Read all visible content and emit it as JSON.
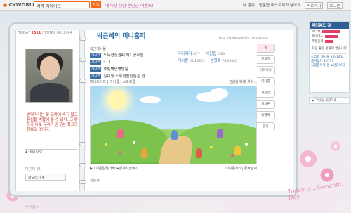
{
  "topbar": {
    "logo": "CYWORLD",
    "search_value": "박봉 리에이크",
    "search_button": "검색",
    "promo": "예식장 싱담·혼인금 이벤트!",
    "nav": [
      "내 홈피",
      "방문한 히스토리가 남아요",
      "비로가기",
      "로그인"
    ]
  },
  "left_page": {
    "today_label": "TODAY",
    "today_value": "2511",
    "total_label": "TOTAL",
    "total_value": "8012004",
    "quote": "번역거리는 꽃 모양에 속지 않고 진심을 벅뽑에 볼 수 있다. 그 렁하가 바로 우리가 꿈꾸는 최고의 행복일 것이다.",
    "history_label": "HISTORY",
    "owner_name": "박근혜",
    "owner_suffix": "(9)",
    "pado_label": "파도타기"
  },
  "right_page": {
    "title": "박근혜의 미니홈피",
    "url": "http://www.cyworld.com/ghism",
    "recent_label": "최근게시물",
    "recent_items": [
      {
        "tag": "게시판",
        "text": "노무현정권때 왜? 공무원..."
      },
      {
        "tag": "게시판",
        "text": "- · l"
      },
      {
        "tag": "게시판",
        "text": "효림벽만명방문"
      },
      {
        "tag": "게시판",
        "text": "김대중·노무현할만들은 한..."
      }
    ],
    "stats": [
      {
        "name": "다이어리",
        "value": "0/77",
        "name2": "사진첩",
        "value2": "0/85"
      },
      {
        "name": "게시판",
        "value": "64/18825",
        "name2": "방명록",
        "value2": "76/59485"
      },
      {
        "name": "",
        "value": "",
        "name2": "",
        "value2": ""
      }
    ],
    "mini_room_label": "미니라이프 | 미니룸 | 스토리룸",
    "mini_room_right": "전설을 타네 샤바...",
    "caption_left": "▶미니룸알릴거비 ▶함께사진찍기",
    "caption_right": "미니룸수비| 경작검지",
    "ilchon_label": "일촌평"
  },
  "tabs": [
    "홈",
    "프로필",
    "다이어리",
    "미니룸",
    "사진첩",
    "게시판",
    "방명록",
    "관리"
  ],
  "side_panel": {
    "title": "쩨이웨드 검",
    "bars": [
      {
        "label": "액티브",
        "value": 0.8
      },
      {
        "label": "페이머스",
        "value": 0.55
      },
      {
        "label": "프렌들리",
        "value": 0.35
      }
    ],
    "note": "자랑 좋은 성볼이 없습니다",
    "stats": [
      {
        "label": "스크랩 게시물",
        "value": "164183"
      },
      {
        "label": "즐겨찾기",
        "value": "10711"
      }
    ],
    "link": "사람중이미!폴 ▶선물보자",
    "player_label": "그인을 설정하세"
  },
  "decor": {
    "today_is": "Today is...Romantic Day",
    "brand": "싸이월드"
  },
  "colors": {
    "accent": "#f46b1d",
    "link": "#2c6aa6",
    "quote": "#c0392b",
    "pink": "#e23f6a"
  }
}
